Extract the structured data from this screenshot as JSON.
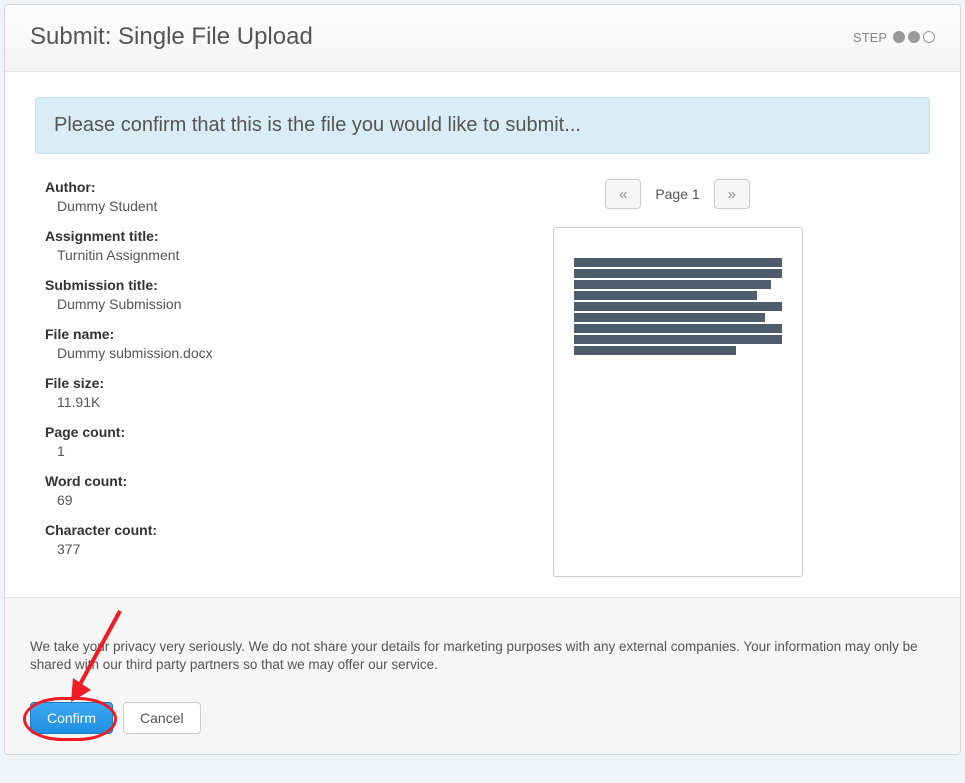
{
  "header": {
    "title": "Submit: Single File Upload",
    "step_label": "STEP"
  },
  "banner": {
    "text": "Please confirm that this is the file you would like to submit..."
  },
  "meta": {
    "author_label": "Author:",
    "author_value": "Dummy Student",
    "assignment_label": "Assignment title:",
    "assignment_value": "Turnitin Assignment",
    "submission_label": "Submission title:",
    "submission_value": "Dummy Submission",
    "filename_label": "File name:",
    "filename_value": "Dummy submission.docx",
    "filesize_label": "File size:",
    "filesize_value": "11.91K",
    "pagecount_label": "Page count:",
    "pagecount_value": "1",
    "wordcount_label": "Word count:",
    "wordcount_value": "69",
    "charcount_label": "Character count:",
    "charcount_value": "377"
  },
  "pager": {
    "prev_glyph": "«",
    "label": "Page 1",
    "next_glyph": "»"
  },
  "footer": {
    "privacy": "We take your privacy very seriously. We do not share your details for marketing purposes with any external companies. Your information may only be shared with our third party partners so that we may offer our service.",
    "confirm_label": "Confirm",
    "cancel_label": "Cancel"
  }
}
